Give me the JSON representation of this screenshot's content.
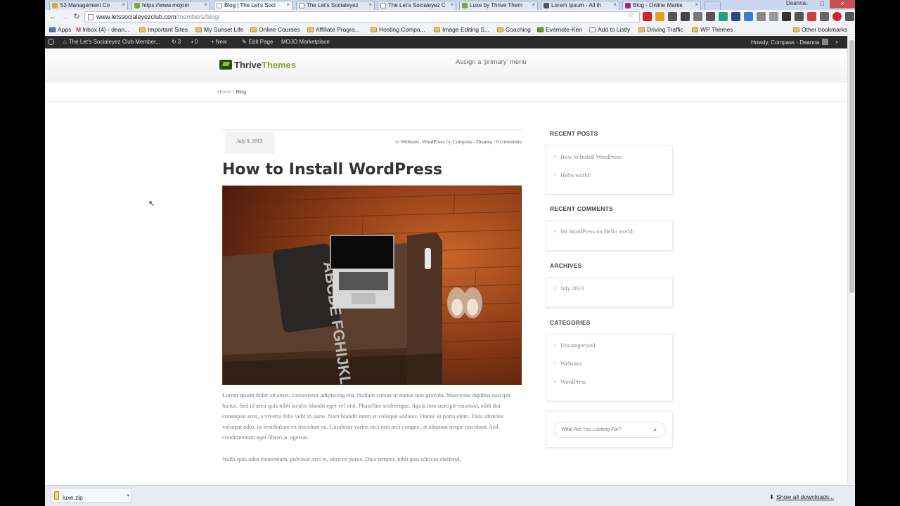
{
  "browser": {
    "tabs": [
      {
        "label": "S3 Management Co",
        "active": false
      },
      {
        "label": "https://www.mojom",
        "active": false
      },
      {
        "label": "Blog | The Let's Soci",
        "active": true
      },
      {
        "label": "The Let's Socialeyez",
        "active": false
      },
      {
        "label": "The Let's Socialeyez C",
        "active": false
      },
      {
        "label": "Luxe by Thrive Them",
        "active": false
      },
      {
        "label": "Lorem Ipsum - All th",
        "active": false
      },
      {
        "label": "Blog - Online Marke",
        "active": false
      }
    ],
    "profile_name": "Deanna",
    "url_host": "www.letssocialeyezclub.com",
    "url_path": "/members/blog/",
    "bookmarks": [
      {
        "label": "Apps",
        "kind": "apps"
      },
      {
        "label": "Inbox (4) - dean...",
        "kind": "mail"
      },
      {
        "label": "Important Sites",
        "kind": "folder"
      },
      {
        "label": "My Sunset Life",
        "kind": "folder"
      },
      {
        "label": "Online Courses",
        "kind": "folder"
      },
      {
        "label": "Affiliate Progra...",
        "kind": "folder"
      },
      {
        "label": "Hosting Compa...",
        "kind": "folder"
      },
      {
        "label": "Image Editing S...",
        "kind": "folder"
      },
      {
        "label": "Coaching",
        "kind": "folder"
      },
      {
        "label": "Evernote-Ken",
        "kind": "page"
      },
      {
        "label": "Add to Listly",
        "kind": "page"
      },
      {
        "label": "Driving Traffic",
        "kind": "folder"
      },
      {
        "label": "WP Themes",
        "kind": "folder"
      },
      {
        "label": "Other bookmarks",
        "kind": "folder"
      }
    ]
  },
  "adminbar": {
    "site_name": "The Let's Socialeyez Club Member...",
    "updates": "3",
    "comments": "0",
    "new_label": "New",
    "edit_label": "Edit Page",
    "mojo_label": "MOJO Marketplace",
    "greeting": "Howdy, Compass - Deanna"
  },
  "site": {
    "logo_word1": "Thrive",
    "logo_word2": "Themes",
    "menu_notice": "Assign a 'primary' menu",
    "breadcrumb_home": "Home",
    "breadcrumb_sep": "/",
    "breadcrumb_current": "Blog"
  },
  "post": {
    "date": "July 9, 2013",
    "byline_in": "in",
    "category1": "Websites",
    "category2": "WordPress",
    "byline_by": "by",
    "author": "Compass - Deanna",
    "separator": "|",
    "comments": "0 comments",
    "title": "How to Install WordPress",
    "paragraph1": "Lorem ipsum dolor sit amet, consectetur adipiscing elit. Nullam cursus ut metus non gravida. Maecenas dapibus suscipit luctus. Sed id arcu quis nibh iaculis blandit eget vel nisl. Phasellus scelerisque, ligula non suscipit euismod, nibh dui consequat eros, a viverra felis velit in justo. Nam blandit enim et volutpat sodales. Donec et porta enim. Duis ultricies volutpat odio, in vestibulum ex tincidunt eu. Curabitur varius orci non orci congue, ut aliquam neque tincidunt. Sed condimentum eget libero ac egestas.",
    "paragraph2": "Nulla quis odio elementum, pulvinar orci et, ultrices purus. Duis tempor, nibh quis ultrices eleifend,",
    "image_pillow_text": "ABCDE FGHIJKL"
  },
  "sidebar": {
    "recent_posts_title": "RECENT POSTS",
    "recent_posts": [
      "How to Install WordPress",
      "Hello world!"
    ],
    "recent_comments_title": "RECENT COMMENTS",
    "comment_author": "Mr WordPress",
    "comment_on": "on",
    "comment_post": "Hello world!",
    "archives_title": "ARCHIVES",
    "archives": [
      "July 2013"
    ],
    "categories_title": "CATEGORIES",
    "categories": [
      "Uncategorized",
      "Websites",
      "WordPress"
    ],
    "search_placeholder": "What Are You Looking For?"
  },
  "downloads": {
    "file": "luxe.zip",
    "show_all": "Show all downloads..."
  },
  "colors": {
    "brand_green": "#7aa92f",
    "admin_bar": "#2b2b2b"
  }
}
